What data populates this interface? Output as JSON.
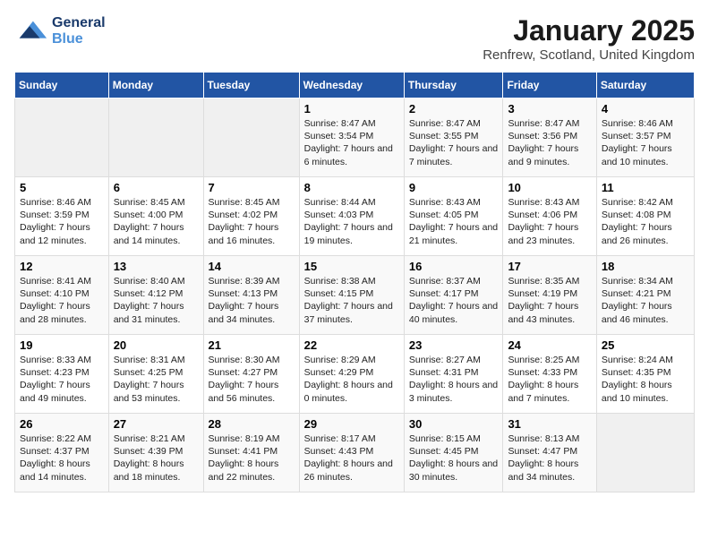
{
  "header": {
    "logo_general": "General",
    "logo_blue": "Blue",
    "title": "January 2025",
    "subtitle": "Renfrew, Scotland, United Kingdom"
  },
  "days_of_week": [
    "Sunday",
    "Monday",
    "Tuesday",
    "Wednesday",
    "Thursday",
    "Friday",
    "Saturday"
  ],
  "weeks": [
    [
      {
        "day": "",
        "info": ""
      },
      {
        "day": "",
        "info": ""
      },
      {
        "day": "",
        "info": ""
      },
      {
        "day": "1",
        "info": "Sunrise: 8:47 AM\nSunset: 3:54 PM\nDaylight: 7 hours and 6 minutes."
      },
      {
        "day": "2",
        "info": "Sunrise: 8:47 AM\nSunset: 3:55 PM\nDaylight: 7 hours and 7 minutes."
      },
      {
        "day": "3",
        "info": "Sunrise: 8:47 AM\nSunset: 3:56 PM\nDaylight: 7 hours and 9 minutes."
      },
      {
        "day": "4",
        "info": "Sunrise: 8:46 AM\nSunset: 3:57 PM\nDaylight: 7 hours and 10 minutes."
      }
    ],
    [
      {
        "day": "5",
        "info": "Sunrise: 8:46 AM\nSunset: 3:59 PM\nDaylight: 7 hours and 12 minutes."
      },
      {
        "day": "6",
        "info": "Sunrise: 8:45 AM\nSunset: 4:00 PM\nDaylight: 7 hours and 14 minutes."
      },
      {
        "day": "7",
        "info": "Sunrise: 8:45 AM\nSunset: 4:02 PM\nDaylight: 7 hours and 16 minutes."
      },
      {
        "day": "8",
        "info": "Sunrise: 8:44 AM\nSunset: 4:03 PM\nDaylight: 7 hours and 19 minutes."
      },
      {
        "day": "9",
        "info": "Sunrise: 8:43 AM\nSunset: 4:05 PM\nDaylight: 7 hours and 21 minutes."
      },
      {
        "day": "10",
        "info": "Sunrise: 8:43 AM\nSunset: 4:06 PM\nDaylight: 7 hours and 23 minutes."
      },
      {
        "day": "11",
        "info": "Sunrise: 8:42 AM\nSunset: 4:08 PM\nDaylight: 7 hours and 26 minutes."
      }
    ],
    [
      {
        "day": "12",
        "info": "Sunrise: 8:41 AM\nSunset: 4:10 PM\nDaylight: 7 hours and 28 minutes."
      },
      {
        "day": "13",
        "info": "Sunrise: 8:40 AM\nSunset: 4:12 PM\nDaylight: 7 hours and 31 minutes."
      },
      {
        "day": "14",
        "info": "Sunrise: 8:39 AM\nSunset: 4:13 PM\nDaylight: 7 hours and 34 minutes."
      },
      {
        "day": "15",
        "info": "Sunrise: 8:38 AM\nSunset: 4:15 PM\nDaylight: 7 hours and 37 minutes."
      },
      {
        "day": "16",
        "info": "Sunrise: 8:37 AM\nSunset: 4:17 PM\nDaylight: 7 hours and 40 minutes."
      },
      {
        "day": "17",
        "info": "Sunrise: 8:35 AM\nSunset: 4:19 PM\nDaylight: 7 hours and 43 minutes."
      },
      {
        "day": "18",
        "info": "Sunrise: 8:34 AM\nSunset: 4:21 PM\nDaylight: 7 hours and 46 minutes."
      }
    ],
    [
      {
        "day": "19",
        "info": "Sunrise: 8:33 AM\nSunset: 4:23 PM\nDaylight: 7 hours and 49 minutes."
      },
      {
        "day": "20",
        "info": "Sunrise: 8:31 AM\nSunset: 4:25 PM\nDaylight: 7 hours and 53 minutes."
      },
      {
        "day": "21",
        "info": "Sunrise: 8:30 AM\nSunset: 4:27 PM\nDaylight: 7 hours and 56 minutes."
      },
      {
        "day": "22",
        "info": "Sunrise: 8:29 AM\nSunset: 4:29 PM\nDaylight: 8 hours and 0 minutes."
      },
      {
        "day": "23",
        "info": "Sunrise: 8:27 AM\nSunset: 4:31 PM\nDaylight: 8 hours and 3 minutes."
      },
      {
        "day": "24",
        "info": "Sunrise: 8:25 AM\nSunset: 4:33 PM\nDaylight: 8 hours and 7 minutes."
      },
      {
        "day": "25",
        "info": "Sunrise: 8:24 AM\nSunset: 4:35 PM\nDaylight: 8 hours and 10 minutes."
      }
    ],
    [
      {
        "day": "26",
        "info": "Sunrise: 8:22 AM\nSunset: 4:37 PM\nDaylight: 8 hours and 14 minutes."
      },
      {
        "day": "27",
        "info": "Sunrise: 8:21 AM\nSunset: 4:39 PM\nDaylight: 8 hours and 18 minutes."
      },
      {
        "day": "28",
        "info": "Sunrise: 8:19 AM\nSunset: 4:41 PM\nDaylight: 8 hours and 22 minutes."
      },
      {
        "day": "29",
        "info": "Sunrise: 8:17 AM\nSunset: 4:43 PM\nDaylight: 8 hours and 26 minutes."
      },
      {
        "day": "30",
        "info": "Sunrise: 8:15 AM\nSunset: 4:45 PM\nDaylight: 8 hours and 30 minutes."
      },
      {
        "day": "31",
        "info": "Sunrise: 8:13 AM\nSunset: 4:47 PM\nDaylight: 8 hours and 34 minutes."
      },
      {
        "day": "",
        "info": ""
      }
    ]
  ]
}
